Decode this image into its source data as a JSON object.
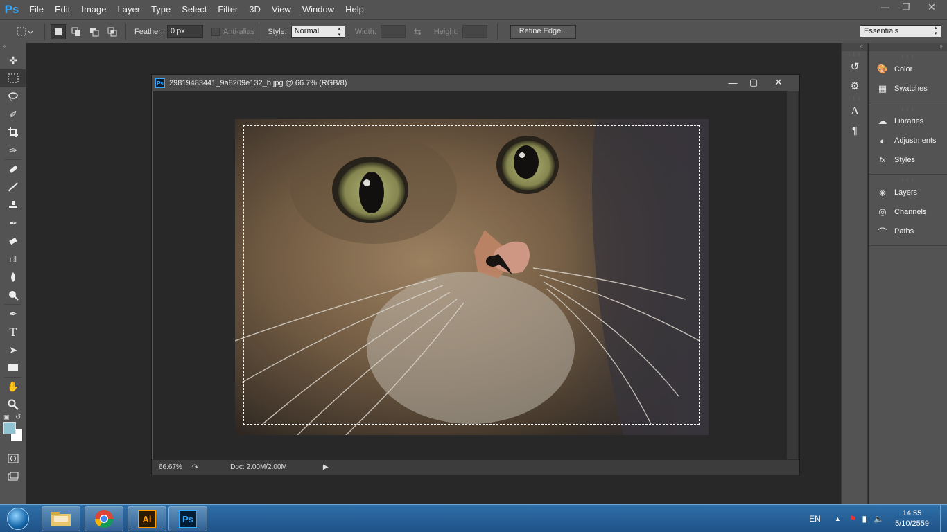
{
  "app": {
    "logo": "Ps",
    "menu": [
      "File",
      "Edit",
      "Image",
      "Layer",
      "Type",
      "Select",
      "Filter",
      "3D",
      "View",
      "Window",
      "Help"
    ]
  },
  "options": {
    "feather_label": "Feather:",
    "feather_value": "0 px",
    "antialias_label": "Anti-alias",
    "style_label": "Style:",
    "style_value": "Normal",
    "width_label": "Width:",
    "height_label": "Height:",
    "refine_edge": "Refine Edge...",
    "workspace": "Essentials"
  },
  "document": {
    "title": "29819483441_9a8209e132_b.jpg @ 66.7% (RGB/8)",
    "zoom": "66.67%",
    "doc_info": "Doc: 2.00M/2.00M"
  },
  "panels": {
    "group1": [
      "Color",
      "Swatches"
    ],
    "group2": [
      "Libraries",
      "Adjustments",
      "Styles"
    ],
    "group3": [
      "Layers",
      "Channels",
      "Paths"
    ]
  },
  "colors": {
    "foreground": "#8fc3d2",
    "background": "#ffffff",
    "accent": "#31a8ff"
  },
  "taskbar": {
    "apps": [
      "file-explorer",
      "chrome",
      "illustrator",
      "photoshop"
    ],
    "illustrator_label": "Ai",
    "photoshop_label": "Ps",
    "language": "EN",
    "time": "14:55",
    "date": "5/10/2559"
  }
}
